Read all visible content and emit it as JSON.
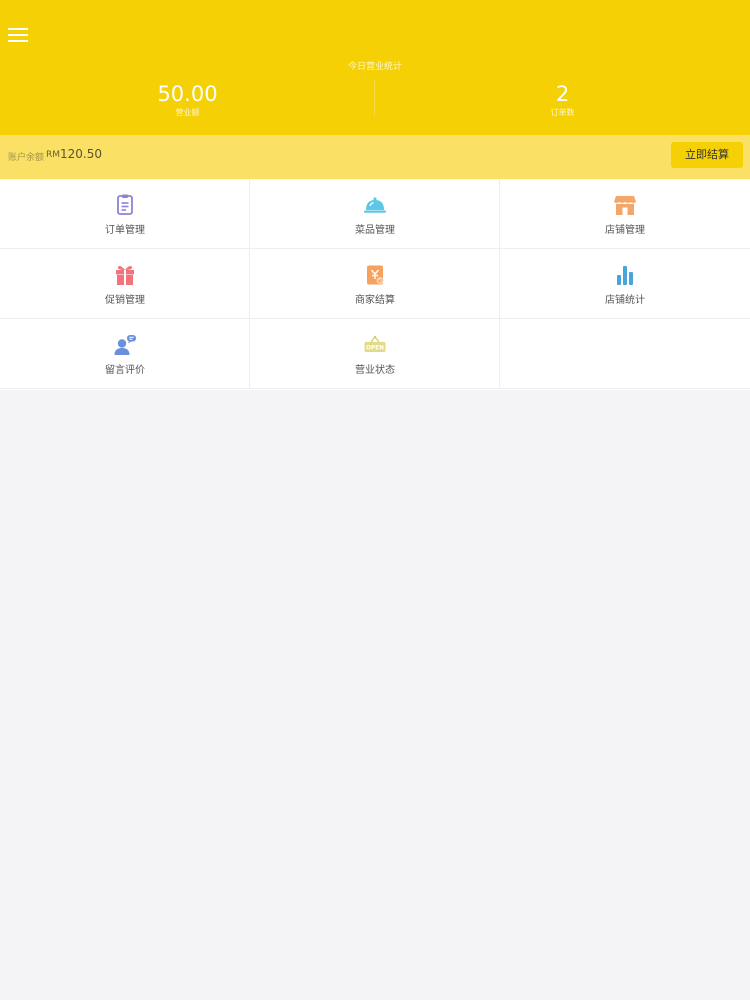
{
  "header": {
    "menu_icon": "hamburger-menu-icon",
    "stats_title": "今日营业统计",
    "stats": [
      {
        "value": "50.00",
        "label": "营业额"
      },
      {
        "value": "2",
        "label": "订单数"
      }
    ],
    "background_color": "#f5d004"
  },
  "balance": {
    "label": "账户余额",
    "currency": "RM",
    "amount": "120.50",
    "settle_button": "立即结算",
    "background_color": "#fae165"
  },
  "menu_grid": [
    {
      "label": "订单管理",
      "icon": "clipboard-icon",
      "color": "#8b83d8"
    },
    {
      "label": "菜品管理",
      "icon": "dish-cloche-icon",
      "color": "#5ec6e6"
    },
    {
      "label": "店铺管理",
      "icon": "storefront-icon",
      "color": "#f4a769"
    },
    {
      "label": "促销管理",
      "icon": "gift-icon",
      "color": "#f2737c"
    },
    {
      "label": "商家结算",
      "icon": "settlement-icon",
      "color": "#f7a15e"
    },
    {
      "label": "店铺统计",
      "icon": "bar-chart-icon",
      "color": "#4ba3dd"
    },
    {
      "label": "留言评价",
      "icon": "user-message-icon",
      "color": "#6c8fdc"
    },
    {
      "label": "营业状态",
      "icon": "open-sign-icon",
      "color": "#d3cc63"
    }
  ]
}
